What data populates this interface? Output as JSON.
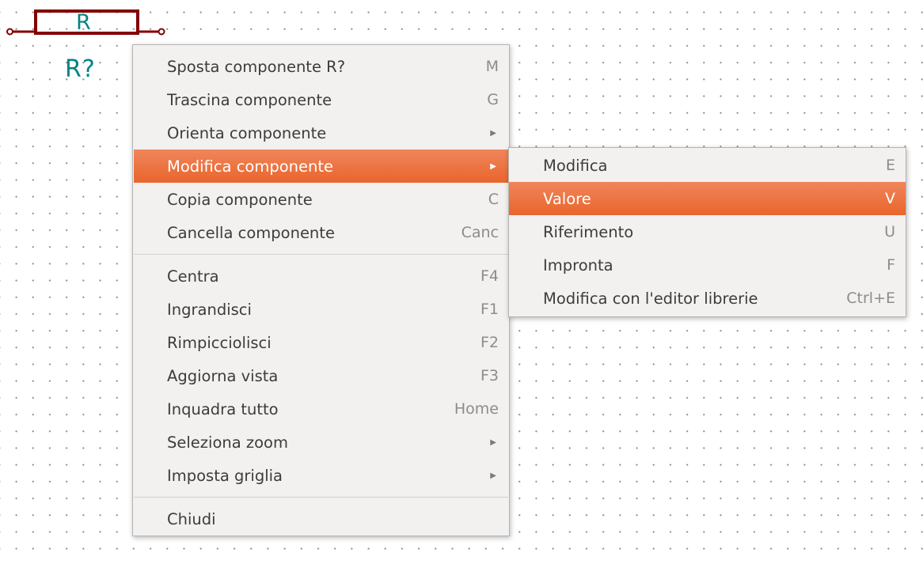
{
  "schematic": {
    "component": {
      "value": "R",
      "reference": "R?",
      "body_color": "#840000",
      "text_color": "#00848a"
    }
  },
  "context_menu": {
    "groups": [
      [
        {
          "label": "Sposta componente R?",
          "shortcut": "M"
        },
        {
          "label": "Trascina componente",
          "shortcut": "G"
        },
        {
          "label": "Orienta componente",
          "has_submenu": true
        },
        {
          "label": "Modifica componente",
          "has_submenu": true,
          "active": true
        },
        {
          "label": "Copia componente",
          "shortcut": "C"
        },
        {
          "label": "Cancella componente",
          "shortcut": "Canc"
        }
      ],
      [
        {
          "label": "Centra",
          "shortcut": "F4"
        },
        {
          "label": "Ingrandisci",
          "shortcut": "F1"
        },
        {
          "label": "Rimpicciolisci",
          "shortcut": "F2"
        },
        {
          "label": "Aggiorna vista",
          "shortcut": "F3"
        },
        {
          "label": "Inquadra tutto",
          "shortcut": "Home"
        },
        {
          "label": "Seleziona zoom",
          "has_submenu": true
        },
        {
          "label": "Imposta griglia",
          "has_submenu": true
        }
      ],
      [
        {
          "label": "Chiudi"
        }
      ]
    ]
  },
  "submenu": {
    "items": [
      {
        "label": "Modifica",
        "shortcut": "E"
      },
      {
        "label": "Valore",
        "shortcut": "V",
        "active": true
      },
      {
        "label": "Riferimento",
        "shortcut": "U"
      },
      {
        "label": "Impronta",
        "shortcut": "F"
      },
      {
        "label": "Modifica con l'editor librerie",
        "shortcut": "Ctrl+E"
      }
    ]
  },
  "theme": {
    "menu_bg": "#f2f1f0",
    "highlight": "#e9652d",
    "grid_dot": "#8d8d8d"
  },
  "icons": {
    "submenu_arrow": "submenu-arrow-icon",
    "pin_end": "pin-end-icon"
  }
}
